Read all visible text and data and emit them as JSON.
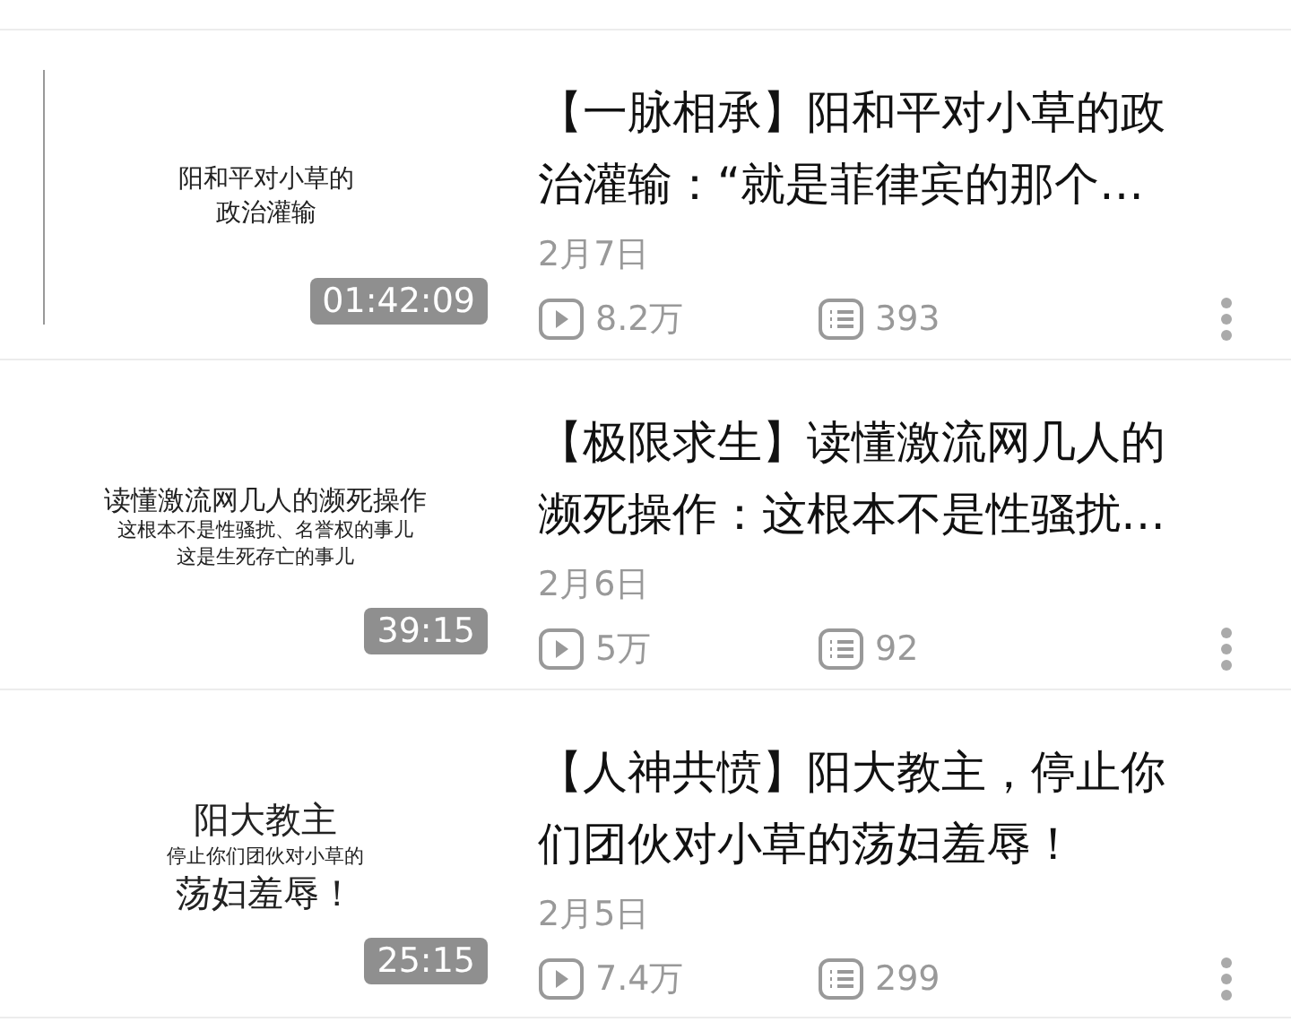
{
  "videos": [
    {
      "cover_lines": [
        {
          "text": "阳和平对小草的",
          "kind": "sans"
        },
        {
          "text": "政治灌输",
          "kind": "sans"
        }
      ],
      "duration": "01:42:09",
      "title_lines": [
        "【一脉相承】阳和平对小草的政",
        "治灌输：“就是菲律宾的那个…"
      ],
      "date": "2月7日",
      "plays": "8.2万",
      "comments": "393"
    },
    {
      "cover_lines": [
        {
          "text": "读懂激流网几人的濒死操作",
          "kind": "serif"
        },
        {
          "text": "这根本不是性骚扰、名誉权的事儿",
          "kind": "serif-small"
        },
        {
          "text": "这是生死存亡的事儿",
          "kind": "serif-small"
        }
      ],
      "duration": "39:15",
      "title_lines": [
        "【极限求生】读懂激流网几人的",
        "濒死操作：这根本不是性骚扰…"
      ],
      "date": "2月6日",
      "plays": "5万",
      "comments": "92"
    },
    {
      "cover_lines": [
        {
          "text": "阳大教主",
          "kind": "serif-large"
        },
        {
          "text": "停止你们团伙对小草的",
          "kind": "serif-small"
        },
        {
          "text": "荡妇羞辱！",
          "kind": "serif-large"
        }
      ],
      "duration": "25:15",
      "title_lines": [
        "【人神共愤】阳大教主，停止你",
        "们团伙对小草的荡妇羞辱！"
      ],
      "date": "2月5日",
      "plays": "7.4万",
      "comments": "299"
    }
  ]
}
